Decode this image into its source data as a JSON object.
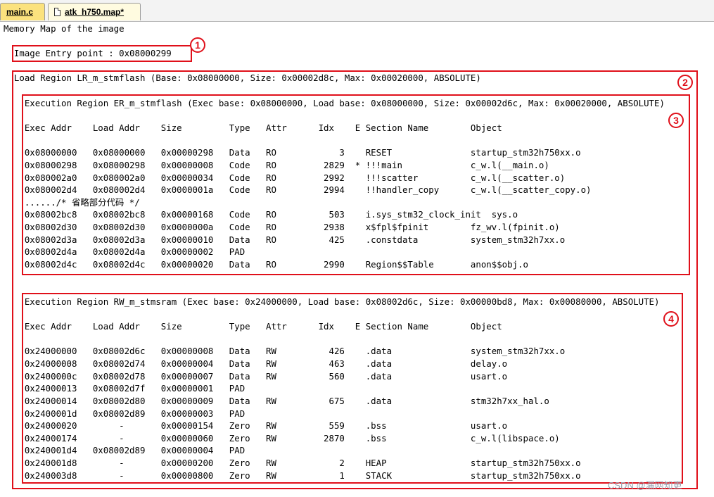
{
  "tabs": [
    {
      "label": "main.c",
      "active": false
    },
    {
      "label": "atk_h750.map*",
      "active": true
    }
  ],
  "lines": [
    "Memory Map of the image",
    "  Image Entry point : 0x08000299",
    "  Load Region LR_m_stmflash (Base: 0x08000000, Size: 0x00002d8c, Max: 0x00020000, ABSOLUTE)",
    "    Execution Region ER_m_stmflash (Exec base: 0x08000000, Load base: 0x08000000, Size: 0x00002d6c, Max: 0x00020000, ABSOLUTE)",
    "    Exec Addr    Load Addr    Size         Type   Attr      Idx    E Section Name        Object",
    "    0x08000000   0x08000000   0x00000298   Data   RO            3    RESET               startup_stm32h750xx.o",
    "    0x08000298   0x08000298   0x00000008   Code   RO         2829  * !!!main             c_w.l(__main.o)",
    "    0x080002a0   0x080002a0   0x00000034   Code   RO         2992    !!!scatter          c_w.l(__scatter.o)",
    "    0x080002d4   0x080002d4   0x0000001a   Code   RO         2994    !!handler_copy      c_w.l(__scatter_copy.o)",
    "    ....../* 省略部分代码 */",
    "    0x08002bc8   0x08002bc8   0x00000168   Code   RO          503    i.sys_stm32_clock_init  sys.o",
    "    0x08002d30   0x08002d30   0x0000000a   Code   RO         2938    x$fpl$fpinit        fz_wv.l(fpinit.o)",
    "    0x08002d3a   0x08002d3a   0x00000010   Data   RO          425    .constdata          system_stm32h7xx.o",
    "    0x08002d4a   0x08002d4a   0x00000002   PAD",
    "    0x08002d4c   0x08002d4c   0x00000020   Data   RO         2990    Region$$Table       anon$$obj.o",
    "    Execution Region RW_m_stmsram (Exec base: 0x24000000, Load base: 0x08002d6c, Size: 0x00000bd8, Max: 0x00080000, ABSOLUTE)",
    "    Exec Addr    Load Addr    Size         Type   Attr      Idx    E Section Name        Object",
    "    0x24000000   0x08002d6c   0x00000008   Data   RW          426    .data               system_stm32h7xx.o",
    "    0x24000008   0x08002d74   0x00000004   Data   RW          463    .data               delay.o",
    "    0x2400000c   0x08002d78   0x00000007   Data   RW          560    .data               usart.o",
    "    0x24000013   0x08002d7f   0x00000001   PAD",
    "    0x24000014   0x08002d80   0x00000009   Data   RW          675    .data               stm32h7xx_hal.o",
    "    0x2400001d   0x08002d89   0x00000003   PAD",
    "    0x24000020        -       0x00000154   Zero   RW          559    .bss                usart.o",
    "    0x24000174        -       0x00000060   Zero   RW         2870    .bss                c_w.l(libspace.o)",
    "    0x240001d4   0x08002d89   0x00000004   PAD",
    "    0x240001d8        -       0x00000200   Zero   RW            2    HEAP                startup_stm32h750xx.o",
    "    0x240003d8        -       0x00000800   Zero   RW            1    STACK               startup_stm32h750xx.o"
  ],
  "annotations": [
    "1",
    "2",
    "3",
    "4"
  ],
  "watermark": "CSDN @漏网知更",
  "colors": {
    "annotation": "#e0101a",
    "active_tab": "#fffbe0",
    "inactive_tab": "#fbe27e"
  }
}
